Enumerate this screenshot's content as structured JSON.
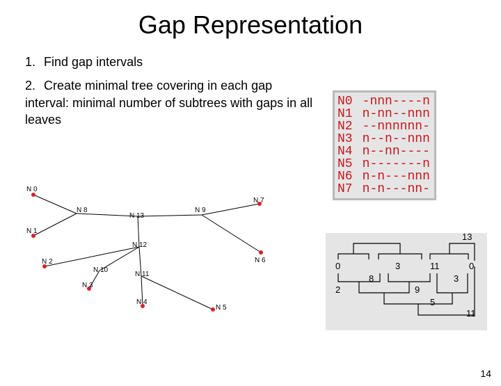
{
  "title": "Gap Representation",
  "list": [
    {
      "n": "1.",
      "text": "Find gap intervals"
    },
    {
      "n": "2.",
      "text": "Create minimal tree covering in each gap interval: minimal number of subtrees with gaps in all leaves"
    }
  ],
  "matrix_labels": [
    "N0",
    "N1",
    "N2",
    "N3",
    "N4",
    "N5",
    "N6",
    "N7"
  ],
  "matrix_seqs": [
    "-nnn----n",
    "n-nn--nnn",
    "--nnnnnn-",
    "n--n--nnn",
    "n--nn----",
    "n-------n",
    "n-n---nnn",
    "n-n---nn-"
  ],
  "highlight_cols": [
    3,
    8
  ],
  "tree_leaves": [
    "N 0",
    "N 1",
    "N 2",
    "N 3",
    "N 4",
    "N 5",
    "N 6",
    "N 7"
  ],
  "tree_internal": [
    "N 8",
    "N 9",
    "N 10",
    "N 11",
    "N 12",
    "N 13"
  ],
  "bracket_top": [
    "13",
    "0",
    "3",
    "11",
    "0"
  ],
  "bracket_bottom": [
    "2",
    "8",
    "9",
    "3",
    "5",
    "11"
  ],
  "page": "14"
}
